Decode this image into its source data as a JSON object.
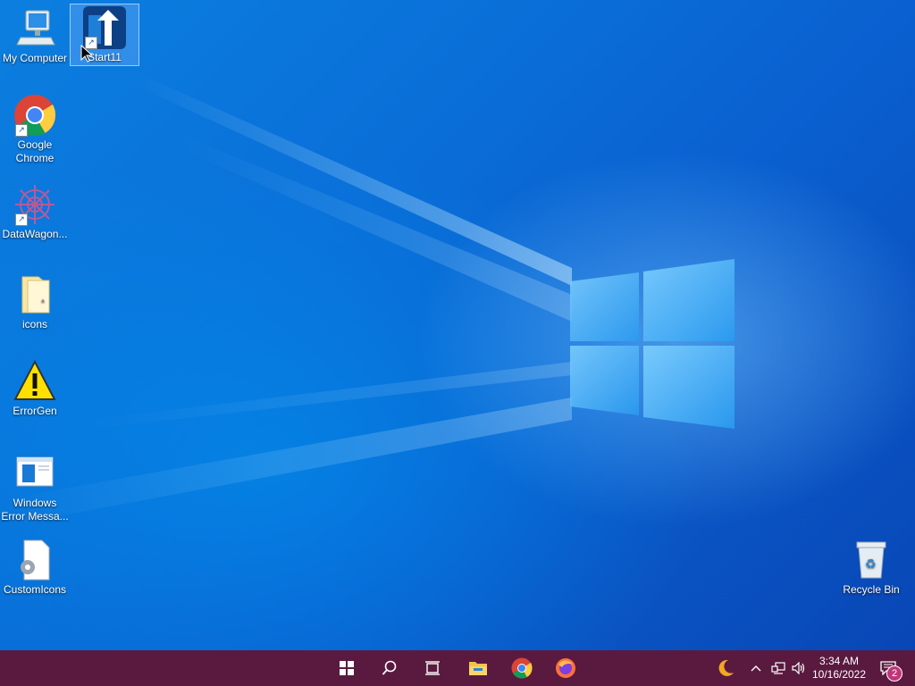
{
  "desktop": {
    "icons": [
      {
        "label": "My Computer",
        "icon": "computer-icon"
      },
      {
        "label": "Start11",
        "icon": "start11-icon"
      },
      {
        "label": "Google Chrome",
        "icon": "chrome-icon"
      },
      {
        "label": "DataWagon...",
        "icon": "datawagon-icon"
      },
      {
        "label": "icons",
        "icon": "folder-icon"
      },
      {
        "label": "ErrorGen",
        "icon": "warning-icon"
      },
      {
        "label": "Windows Error Messa...",
        "icon": "window-app-icon"
      },
      {
        "label": "CustomIcons",
        "icon": "settings-file-icon"
      },
      {
        "label": "Recycle Bin",
        "icon": "recycle-bin-icon"
      }
    ]
  },
  "taskbar": {
    "color": "#5a1a3f",
    "buttons": [
      {
        "name": "start",
        "icon": "windows-logo-icon"
      },
      {
        "name": "search",
        "icon": "search-icon"
      },
      {
        "name": "task-view",
        "icon": "task-view-icon"
      },
      {
        "name": "file-explorer",
        "icon": "folder-icon"
      },
      {
        "name": "chrome",
        "icon": "chrome-icon"
      },
      {
        "name": "firefox",
        "icon": "firefox-icon"
      }
    ],
    "tray": {
      "time": "3:34 AM",
      "date": "10/16/2022",
      "notification_count": "2"
    }
  }
}
